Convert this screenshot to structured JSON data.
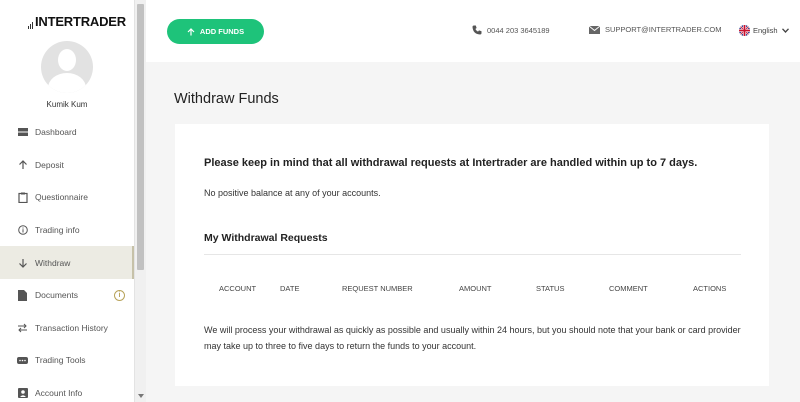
{
  "brand": {
    "name": "INTERTRADER"
  },
  "user": {
    "name": "Kumik Kum"
  },
  "sidebar": {
    "items": [
      {
        "label": "Dashboard",
        "icon": "dashboard-icon"
      },
      {
        "label": "Deposit",
        "icon": "arrow-up-icon"
      },
      {
        "label": "Questionnaire",
        "icon": "clipboard-icon"
      },
      {
        "label": "Trading info",
        "icon": "info-icon"
      },
      {
        "label": "Withdraw",
        "icon": "arrow-down-icon",
        "active": true
      },
      {
        "label": "Documents",
        "icon": "document-icon",
        "badge": "i"
      },
      {
        "label": "Transaction History",
        "icon": "transfer-icon"
      },
      {
        "label": "Trading Tools",
        "icon": "tools-icon"
      },
      {
        "label": "Account Info",
        "icon": "account-icon"
      }
    ]
  },
  "header": {
    "add_funds_label": "ADD FUNDS",
    "phone": "0044 203 3645189",
    "email": "SUPPORT@INTERTRADER.COM",
    "language": "English"
  },
  "main": {
    "title": "Withdraw Funds",
    "notice": "Please keep in mind that all withdrawal requests at Intertrader are handled within up to 7 days.",
    "balance_message": "No positive balance at any of your accounts.",
    "requests_title": "My Withdrawal Requests",
    "table_headers": [
      "ACCOUNT",
      "DATE",
      "REQUEST NUMBER",
      "AMOUNT",
      "STATUS",
      "COMMENT",
      "ACTIONS"
    ],
    "info": "We will process your withdrawal as quickly as possible and usually within 24 hours, but you should note that your bank or card provider may take up to three to five days to return the funds to your account."
  },
  "colors": {
    "accent_green": "#1ec37a",
    "active_item_bg": "#ecebe3",
    "badge_gold": "#b8a35a"
  }
}
